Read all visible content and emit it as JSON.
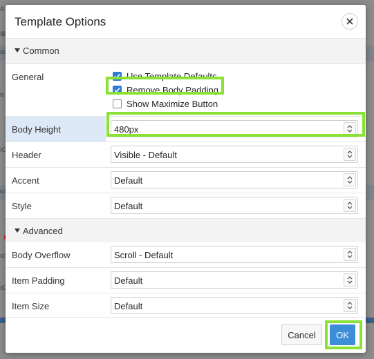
{
  "dialog": {
    "title": "Template Options",
    "close_icon": "close-icon"
  },
  "sections": {
    "common": {
      "label": "Common",
      "expanded": true
    },
    "advanced": {
      "label": "Advanced",
      "expanded": true
    }
  },
  "general": {
    "label": "General",
    "checkboxes": [
      {
        "label": "Use Template Defaults",
        "checked": true
      },
      {
        "label": "Remove Body Padding",
        "checked": true
      },
      {
        "label": "Show Maximize Button",
        "checked": false
      }
    ]
  },
  "fields": {
    "body_height": {
      "label": "Body Height",
      "value": "480px"
    },
    "header": {
      "label": "Header",
      "value": "Visible - Default"
    },
    "accent": {
      "label": "Accent",
      "value": "Default"
    },
    "style": {
      "label": "Style",
      "value": "Default"
    },
    "body_overflow": {
      "label": "Body Overflow",
      "value": "Scroll - Default"
    },
    "item_padding": {
      "label": "Item Padding",
      "value": "Default"
    },
    "item_size": {
      "label": "Item Size",
      "value": "Default"
    }
  },
  "footer": {
    "cancel_label": "Cancel",
    "ok_label": "OK"
  },
  "background": {
    "fragments": [
      "AT",
      "IB",
      "od",
      "ic",
      "IC",
      "ict",
      "IC",
      "IC"
    ]
  },
  "colors": {
    "accent": "#3d8ed9",
    "checkbox_on": "#2f7bd6",
    "highlight": "#8ae234",
    "active_row": "#dde9f7"
  }
}
